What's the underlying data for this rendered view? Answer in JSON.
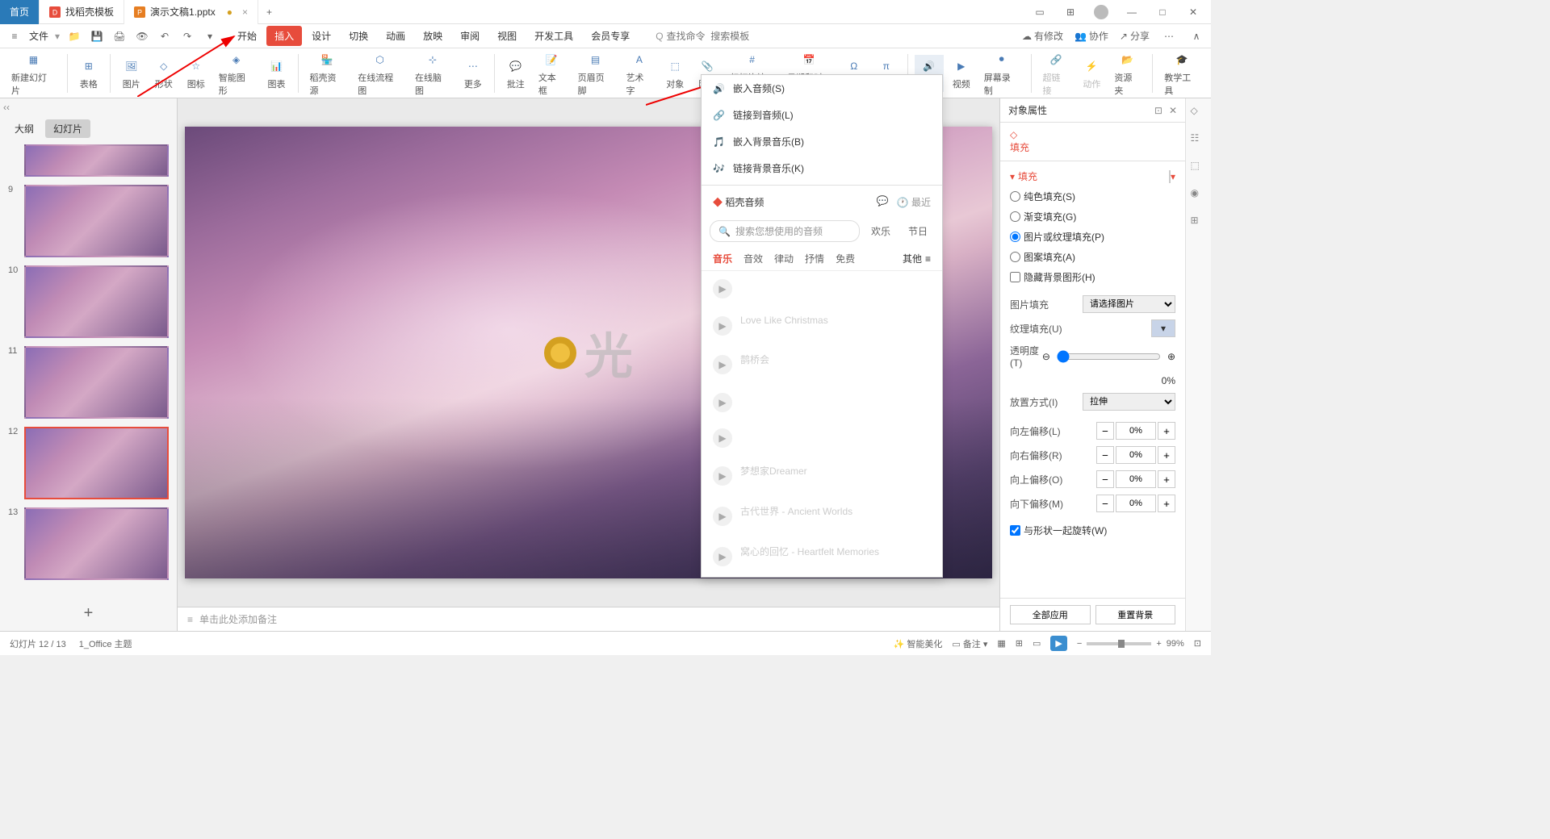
{
  "tabs": {
    "home": "首页",
    "t1": "找稻壳模板",
    "t2": "演示文稿1.pptx"
  },
  "menubar": {
    "file": "文件",
    "tabs": [
      "开始",
      "插入",
      "设计",
      "切换",
      "动画",
      "放映",
      "审阅",
      "视图",
      "开发工具",
      "会员专享"
    ],
    "activeTab": "插入",
    "searchIcon": "Q",
    "searchHint": "查找命令  搜索模板",
    "right": {
      "pending": "有修改",
      "collab": "协作",
      "share": "分享"
    }
  },
  "ribbon": {
    "items": [
      "新建幻灯片",
      "表格",
      "图片",
      "形状",
      "图标",
      "智能图形",
      "图表",
      "稻壳资源",
      "在线流程图",
      "在线脑图",
      "更多",
      "批注",
      "文本框",
      "页眉页脚",
      "艺术字",
      "对象",
      "附件",
      "幻灯片编号",
      "日期和时间",
      "符号",
      "公式",
      "音频",
      "视频",
      "屏幕录制",
      "超链接",
      "动作",
      "资源夹",
      "教学工具"
    ]
  },
  "slidePanel": {
    "tab1": "大纲",
    "tab2": "幻灯片",
    "nums": [
      "9",
      "10",
      "11",
      "12",
      "13"
    ]
  },
  "dropdown": {
    "items": [
      "嵌入音频(S)",
      "链接到音频(L)",
      "嵌入背景音乐(B)",
      "链接背景音乐(K)"
    ],
    "resTitle": "稻壳音频",
    "recent": "最近",
    "searchPlaceholder": "搜索您想使用的音频",
    "chips": [
      "欢乐",
      "节日"
    ],
    "cats": [
      "音乐",
      "音效",
      "律动",
      "抒情",
      "免费"
    ],
    "catMore": "其他",
    "tracks": [
      {
        "title": "",
        "meta": ""
      },
      {
        "title": "Love Like Christmas",
        "meta": ""
      },
      {
        "title": "鹊桥会",
        "meta": ""
      },
      {
        "title": "",
        "meta": ""
      },
      {
        "title": "",
        "meta": ""
      },
      {
        "title": "梦想家Dreamer",
        "meta": ""
      },
      {
        "title": "古代世界 - Ancient Worlds",
        "meta": ""
      },
      {
        "title": "窝心的回忆 - Heartfelt Memories",
        "meta": ""
      }
    ]
  },
  "rightPanel": {
    "title": "对象属性",
    "fillTab": "填充",
    "fillSection": "填充",
    "radios": {
      "solid": "纯色填充(S)",
      "gradient": "渐变填充(G)",
      "picture": "图片或纹理填充(P)",
      "pattern": "图案填充(A)",
      "hideBg": "隐藏背景图形(H)"
    },
    "picFill": "图片填充",
    "picFillVal": "请选择图片",
    "texFill": "纹理填充(U)",
    "opacity": "透明度(T)",
    "opacityVal": "0%",
    "tile": "放置方式(I)",
    "tileVal": "拉伸",
    "offsets": {
      "left": "向左偏移(L)",
      "right": "向右偏移(R)",
      "up": "向上偏移(O)",
      "down": "向下偏移(M)"
    },
    "offsetVal": "0%",
    "rotate": "与形状一起旋转(W)",
    "applyAll": "全部应用",
    "resetBg": "重置背景"
  },
  "notes": "单击此处添加备注",
  "status": {
    "slide": "幻灯片 12 / 13",
    "theme": "1_Office 主题",
    "beauty": "智能美化",
    "notes": "备注",
    "zoom": "99%"
  },
  "watermark": "光"
}
